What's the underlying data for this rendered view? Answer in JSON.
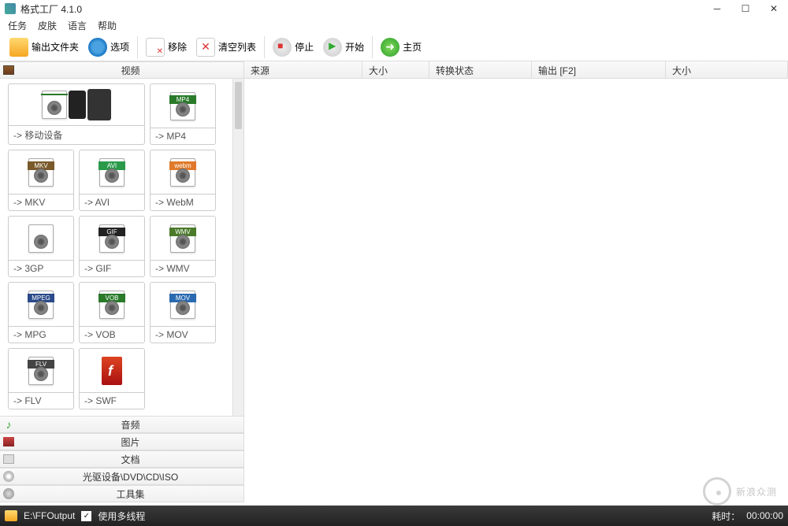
{
  "window": {
    "title": "格式工厂 4.1.0"
  },
  "menu": {
    "task": "任务",
    "skin": "皮肤",
    "lang": "语言",
    "help": "帮助"
  },
  "toolbar": {
    "output_folder": "输出文件夹",
    "options": "选项",
    "remove": "移除",
    "clear": "清空列表",
    "stop": "停止",
    "start": "开始",
    "home": "主页"
  },
  "categories": {
    "video": "视频",
    "audio": "音频",
    "image": "图片",
    "document": "文档",
    "disc": "光驱设备\\DVD\\CD\\ISO",
    "tools": "工具集"
  },
  "formats": [
    {
      "key": "mobile",
      "label": "-> 移动设备",
      "wide": true,
      "glyph": "devices"
    },
    {
      "key": "mp4",
      "label": "-> MP4",
      "badge": "MP4",
      "cls": "badge-mp4"
    },
    {
      "key": "mkv",
      "label": "-> MKV",
      "badge": "MKV",
      "cls": "badge-mkv"
    },
    {
      "key": "avi",
      "label": "-> AVI",
      "badge": "AVI",
      "cls": "badge-avi"
    },
    {
      "key": "webm",
      "label": "-> WebM",
      "badge": "webm",
      "cls": "badge-webm"
    },
    {
      "key": "3gp",
      "label": "-> 3GP",
      "badge": "",
      "cls": "badge-3gp"
    },
    {
      "key": "gif",
      "label": "-> GIF",
      "badge": "GIF",
      "cls": "badge-gif"
    },
    {
      "key": "wmv",
      "label": "-> WMV",
      "badge": "WMV",
      "cls": "badge-wmv"
    },
    {
      "key": "mpg",
      "label": "-> MPG",
      "badge": "MPEG",
      "cls": "badge-mpeg"
    },
    {
      "key": "vob",
      "label": "-> VOB",
      "badge": "VOB",
      "cls": "badge-vob"
    },
    {
      "key": "mov",
      "label": "-> MOV",
      "badge": "MOV",
      "cls": "badge-mov"
    },
    {
      "key": "flv",
      "label": "-> FLV",
      "badge": "FLV",
      "cls": "badge-flv"
    },
    {
      "key": "swf",
      "label": "-> SWF",
      "glyph": "swf"
    }
  ],
  "list_columns": {
    "source": "来源",
    "size1": "大小",
    "status": "转换状态",
    "output": "输出 [F2]",
    "size2": "大小"
  },
  "statusbar": {
    "output_path": "E:\\FFOutput",
    "multithread": "使用多线程",
    "elapsed_label": "耗时：",
    "elapsed_value": "00:00:00"
  },
  "watermark": "新浪众测"
}
